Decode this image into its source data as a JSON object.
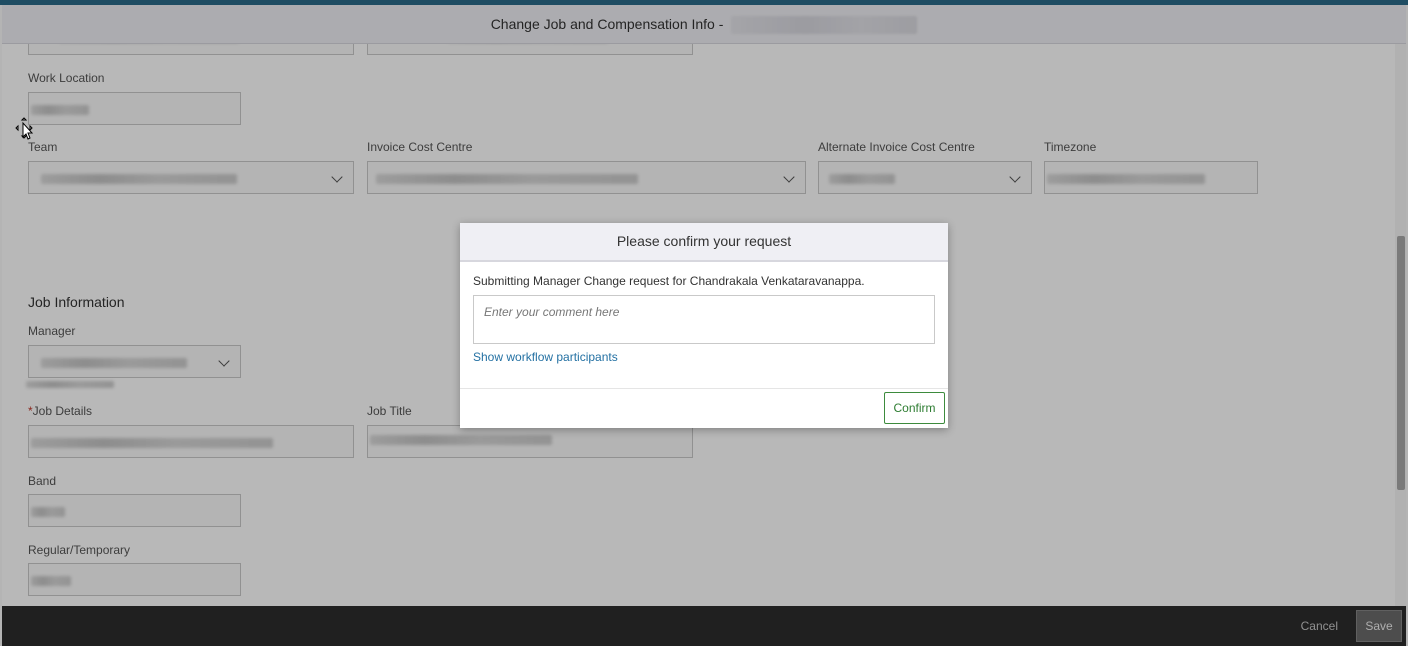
{
  "header": {
    "title": "Change Job and Compensation Info -"
  },
  "form": {
    "work_location": {
      "label": "Work Location"
    },
    "team": {
      "label": "Team"
    },
    "invoice_cost_centre": {
      "label": "Invoice Cost Centre"
    },
    "alt_invoice_cost_centre": {
      "label": "Alternate Invoice Cost Centre"
    },
    "timezone": {
      "label": "Timezone"
    },
    "job_information": {
      "title": "Job Information"
    },
    "manager": {
      "label": "Manager"
    },
    "job_details": {
      "label": "Job Details",
      "required_mark": "*"
    },
    "job_title": {
      "label": "Job Title"
    },
    "band": {
      "label": "Band"
    },
    "regular_temporary": {
      "label": "Regular/Temporary"
    }
  },
  "footer": {
    "cancel_label": "Cancel",
    "save_label": "Save"
  },
  "dialog": {
    "title": "Please confirm your request",
    "message": "Submitting Manager Change request for Chandrakala Venkataravanappa.",
    "comment_placeholder": "Enter your comment here",
    "link_label": "Show workflow participants",
    "confirm_label": "Confirm"
  },
  "colors": {
    "accent": "#2b6b8a",
    "link": "#2471a3",
    "confirm": "#2e7d32",
    "footer_bg": "#2d2d2d"
  }
}
